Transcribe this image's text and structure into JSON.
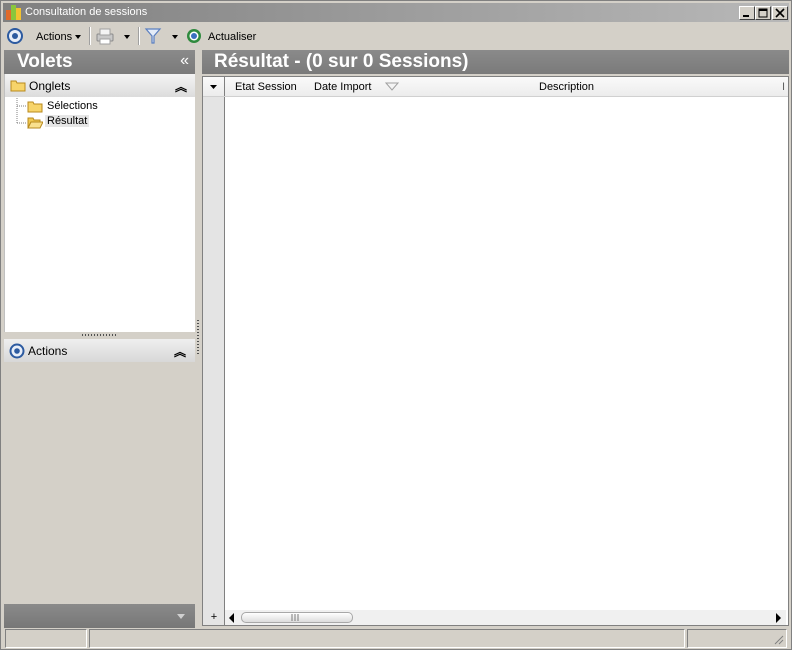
{
  "window": {
    "title": "Consultation de sessions",
    "minimize_icon": "minimize-icon",
    "maximize_icon": "maximize-icon",
    "close_icon": "close-icon"
  },
  "toolbar": {
    "actions_label": "Actions",
    "refresh_label": "Actualiser",
    "icons": [
      "actions-icon",
      "print-icon",
      "filter-icon",
      "refresh-icon"
    ]
  },
  "left_panel": {
    "title": "Volets",
    "collapse_glyph": "«",
    "onglets": {
      "label": "Onglets",
      "items": [
        {
          "label": "Sélections",
          "icon": "folder-icon",
          "selected": false
        },
        {
          "label": "Résultat",
          "icon": "folder-open-icon",
          "selected": true
        }
      ]
    },
    "actions": {
      "label": "Actions"
    }
  },
  "result": {
    "title": "Résultat - (0 sur 0 Sessions)",
    "columns": [
      "Etat Session",
      "Date Import",
      "Description"
    ],
    "rows": []
  },
  "colors": {
    "panel_header": "#808080",
    "window_bg": "#d4d0c8",
    "accent_blue": "#2c5aa0"
  }
}
